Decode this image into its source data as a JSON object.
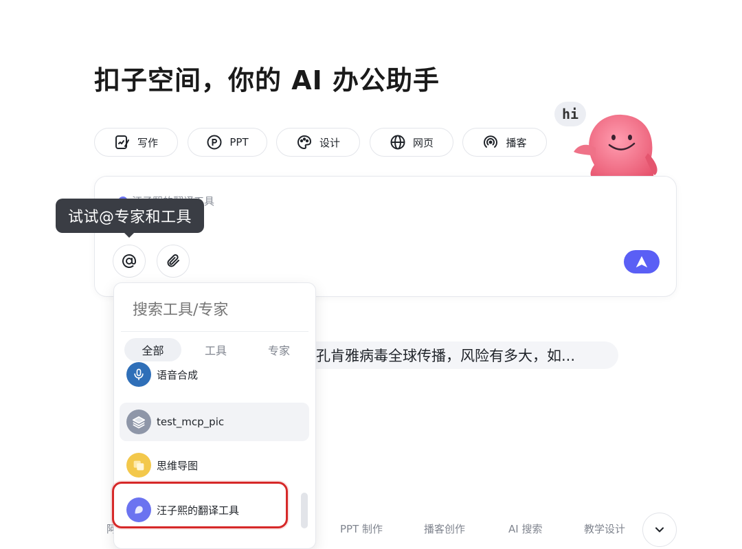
{
  "title": "扣子空间，你的 AI 办公助手",
  "mascot": {
    "greeting": "hi"
  },
  "chips": [
    {
      "label": "写作",
      "icon": "writing-icon"
    },
    {
      "label": "PPT",
      "icon": "ppt-icon"
    },
    {
      "label": "设计",
      "icon": "palette-icon"
    },
    {
      "label": "网页",
      "icon": "globe-icon"
    },
    {
      "label": "播客",
      "icon": "podcast-icon"
    }
  ],
  "input": {
    "mention_tag": "汪子熙的翻译工具",
    "tooltip": "试试@专家和工具"
  },
  "suggestion": "孔肯雅病毒全球传播，风险有多大，如...",
  "dropdown": {
    "search_placeholder": "搜索工具/专家",
    "tabs": [
      "全部",
      "工具",
      "专家"
    ],
    "active_tab": "全部",
    "items": [
      {
        "label": "语音合成",
        "icon": "microphone-avatar-icon"
      },
      {
        "label": "test_mcp_pic",
        "icon": "layers-avatar-icon"
      },
      {
        "label": "思维导图",
        "icon": "mindmap-avatar-icon"
      },
      {
        "label": "汪子熙的翻译工具",
        "icon": "translate-avatar-icon"
      }
    ]
  },
  "bottom_tabs": [
    "PPT 制作",
    "播客创作",
    "AI 搜索",
    "教学设计"
  ],
  "colors": {
    "accent": "#5a5ff5",
    "highlight": "#d62828",
    "tooltip_bg": "#3a3d44"
  }
}
